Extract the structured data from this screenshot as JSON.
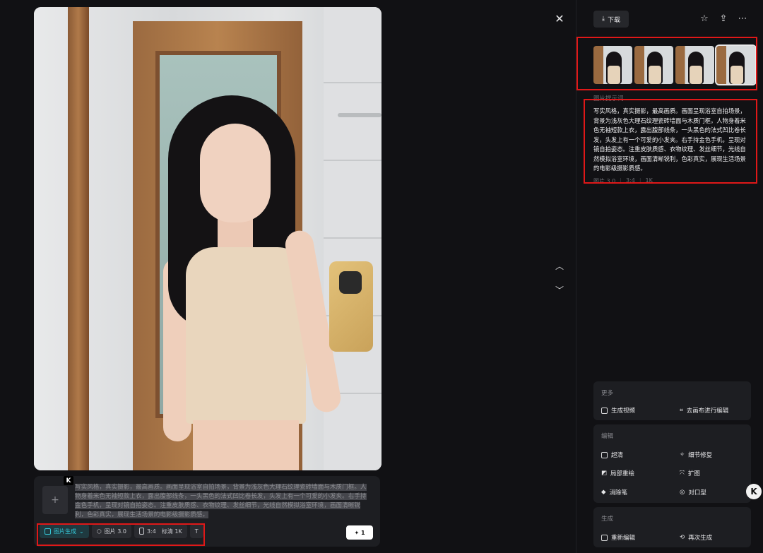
{
  "toolbar": {
    "download_label": "下载"
  },
  "prompt_card": {
    "text": "写实风格，真实摄影，最高画质。画面呈现浴室自拍场景，背景为浅灰色大理石纹理瓷砖墙面与木质门框。人物身着米色无袖短款上衣，露出腹部线条，一头黑色的法式凹比卷长发，头发上有一个可爱的小发夹。右手持金色手机，呈现对镜自拍姿态。注重皮肤质感、衣物纹理、发丝细节，光线自然模拟浴室环境，画面清晰锐利，色彩真实，展现生活场景的电影级摄影质感。",
    "k_badge": "K",
    "add_symbol": "+",
    "tools": {
      "mode_label": "图片生成",
      "model_label": "图片 3.0",
      "ratio_label": "3:4",
      "quality_label": "标清 1K",
      "text_tool_label": "T"
    },
    "send_label": "1"
  },
  "right_panel": {
    "section_label": "图片提示词",
    "description": "写实风格，真实摄影，最高画质。画面呈现浴室自拍场景，背景为浅灰色大理石纹理瓷砖墙面与木质门框。人物身着米色无袖短款上衣，露出腹部线条，一头黑色的法式凹比卷长发，头发上有一个可爱的小发夹。右手持金色手机，呈现对镜自拍姿态。注重皮肤质感、衣物纹理、发丝细节，光线自然模拟浴室环境，画面清晰锐利，色彩真实，展现生活场景的电影级摄影质感。",
    "meta": {
      "model": "图片 3.0",
      "ratio": "3:4",
      "quality": "1K"
    },
    "more": {
      "title": "更多",
      "generate_video": "生成视频",
      "canvas_edit": "去画布进行编辑"
    },
    "edit": {
      "title": "编辑",
      "upscale": "超清",
      "detail_fix": "细节修复",
      "inpaint": "局部重绘",
      "expand": "扩图",
      "eraser": "消除笔",
      "lip_sync": "对口型"
    },
    "generate": {
      "title": "生成",
      "re_edit": "重新编辑",
      "regenerate": "再次生成"
    }
  },
  "floating_badge": "K"
}
